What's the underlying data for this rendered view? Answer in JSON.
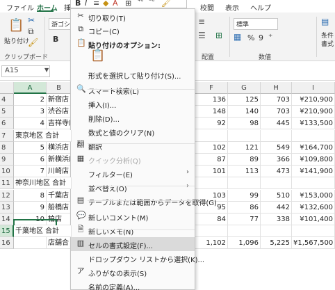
{
  "ribbon": {
    "tabs": [
      "ファイル",
      "ホーム",
      "挿",
      "校閲",
      "表示",
      "ヘルプ"
    ],
    "active_tab": "ホーム",
    "paste_label": "貼り付け",
    "font_name": "游ゴシッ",
    "bold": "B",
    "clipboard_group": "クリップボード",
    "alignment_group": "配置",
    "number_group": "数値",
    "number_format": "標準",
    "percent": "%",
    "comma": "9",
    "conditional_label_1": "条件",
    "conditional_label_2": "書式"
  },
  "formula_bar": {
    "name_box": "A15"
  },
  "columns": [
    "A",
    "B",
    "F",
    "G",
    "H",
    "I"
  ],
  "rows": [
    {
      "num": "4",
      "a": "2",
      "b": "新宿店",
      "f": "136",
      "g": "125",
      "h": "703",
      "i": "¥210,900"
    },
    {
      "num": "5",
      "a": "3",
      "b": "渋谷店",
      "f": "148",
      "g": "140",
      "h": "703",
      "i": "¥210,900"
    },
    {
      "num": "6",
      "a": "4",
      "b": "吉祥寺店",
      "f": "92",
      "g": "98",
      "h": "445",
      "i": "¥133,500"
    },
    {
      "num": "7",
      "a": "東京地区 合計",
      "b": "",
      "f": "",
      "g": "",
      "h": "",
      "i": ""
    },
    {
      "num": "8",
      "a": "5",
      "b": "横浜店",
      "f": "102",
      "g": "121",
      "h": "549",
      "i": "¥164,700"
    },
    {
      "num": "9",
      "a": "6",
      "b": "新横浜店",
      "f": "87",
      "g": "89",
      "h": "366",
      "i": "¥109,800"
    },
    {
      "num": "10",
      "a": "7",
      "b": "川崎店",
      "f": "101",
      "g": "113",
      "h": "473",
      "i": "¥141,900"
    },
    {
      "num": "11",
      "a": "神奈川地区 合計",
      "b": "",
      "f": "",
      "g": "",
      "h": "",
      "i": ""
    },
    {
      "num": "12",
      "a": "8",
      "b": "千葉店",
      "f": "103",
      "g": "99",
      "h": "510",
      "i": "¥153,000"
    },
    {
      "num": "13",
      "a": "9",
      "b": "船橋店",
      "f": "95",
      "g": "86",
      "h": "442",
      "i": "¥132,600"
    },
    {
      "num": "14",
      "a": "10",
      "b": "柏店",
      "f": "84",
      "g": "77",
      "h": "338",
      "i": "¥101,400"
    },
    {
      "num": "15",
      "a": "千葉地区 合計",
      "b": "",
      "f": "",
      "g": "",
      "h": "",
      "i": ""
    },
    {
      "num": "16",
      "a": "",
      "b": "店舗合",
      "f": "1,102",
      "g": "1,096",
      "h": "5,225",
      "i": "¥1,567,500"
    }
  ],
  "context_menu": {
    "items": [
      {
        "icon": "scissors-icon",
        "glyph": "✂",
        "label": "切り取り(T)",
        "enabled": true
      },
      {
        "icon": "copy-icon",
        "glyph": "⧉",
        "label": "コピー(C)",
        "enabled": true
      },
      {
        "icon": "paste-options-icon",
        "glyph": "📋",
        "label": "貼り付けのオプション:",
        "enabled": true,
        "heading": true
      },
      {
        "icon": "paste-icon",
        "glyph": "",
        "label": "",
        "enabled": true
      },
      {
        "icon": "",
        "glyph": "",
        "label": "形式を選択して貼り付け(S)...",
        "enabled": true
      },
      {
        "icon": "smart-lookup-icon",
        "glyph": "🔍",
        "label": "スマート検索(L)",
        "enabled": true
      },
      {
        "icon": "",
        "glyph": "",
        "label": "挿入(I)...",
        "enabled": true
      },
      {
        "icon": "",
        "glyph": "",
        "label": "削除(D)...",
        "enabled": true
      },
      {
        "icon": "",
        "glyph": "",
        "label": "数式と値のクリア(N)",
        "enabled": true
      },
      {
        "icon": "translate-icon",
        "glyph": "翻",
        "label": "翻訳",
        "enabled": true
      },
      {
        "icon": "quick-analysis-icon",
        "glyph": "▦",
        "label": "クイック分析(Q)",
        "enabled": false
      },
      {
        "icon": "",
        "glyph": "",
        "label": "フィルター(E)",
        "enabled": true,
        "submenu": true
      },
      {
        "icon": "",
        "glyph": "",
        "label": "並べ替え(O)",
        "enabled": true,
        "submenu": true
      },
      {
        "icon": "table-range-icon",
        "glyph": "▤",
        "label": "テーブルまたは範囲からデータを取得(G)...",
        "enabled": true
      },
      {
        "icon": "new-comment-icon",
        "glyph": "💬",
        "label": "新しいコメント(M)",
        "enabled": true
      },
      {
        "icon": "new-note-icon",
        "glyph": "🗎",
        "label": "新しいメモ(N)",
        "enabled": true
      },
      {
        "icon": "format-cells-icon",
        "glyph": "▥",
        "label": "セルの書式設定(F)...",
        "enabled": true,
        "highlighted": true
      },
      {
        "icon": "",
        "glyph": "",
        "label": "ドロップダウン リストから選択(K)...",
        "enabled": true
      },
      {
        "icon": "furigana-icon",
        "glyph": "ア",
        "label": "ふりがなの表示(S)",
        "enabled": true
      },
      {
        "icon": "",
        "glyph": "",
        "label": "名前の定義(A)...",
        "enabled": true
      }
    ]
  }
}
